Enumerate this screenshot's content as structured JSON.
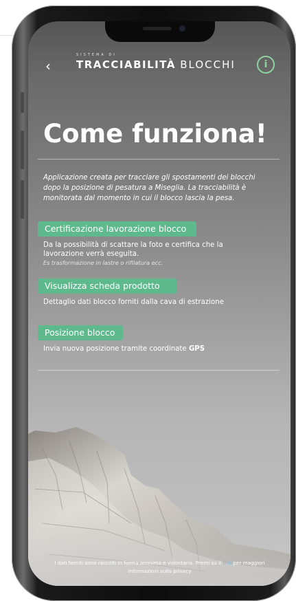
{
  "header": {
    "back_glyph": "‹",
    "logo_small": "SISTEMA DI",
    "logo_bold": "TRACCIABILITÀ",
    "logo_light": "BLOCCHI",
    "info_glyph": "i"
  },
  "title": "Come funziona!",
  "intro": "Applicazione creata per tracciare gli spostamenti dei blocchi dopo la posizione di pesatura a Miseglia. La tracciabilità è monitorata dal momento in cui il blocco lascia la pesa.",
  "features": [
    {
      "label": "Certificazione lavorazione blocco",
      "description": "Da la possibilità di scattare la foto e certifica che la lavorazione verrà eseguita.",
      "note": "Es trasformazione in lastre o rifilatura ecc."
    },
    {
      "label": "Visualizza scheda prodotto",
      "description": "Dettaglio dati blocco forniti dalla cava di estrazione"
    },
    {
      "label": "Posizione blocco",
      "description": "Invia nuova posizione tramite coordinate",
      "emphasis": "GPS"
    }
  ],
  "footer": {
    "text_before": "I dati forniti sono raccolti in forma anonima e volontaria. Premi su il",
    "link": "link",
    "text_after": "per maggiori informazioni sulla privacy"
  },
  "colors": {
    "accent": "#5eb98d",
    "info_icon": "#8ed3a0",
    "link": "#67c0ee"
  }
}
